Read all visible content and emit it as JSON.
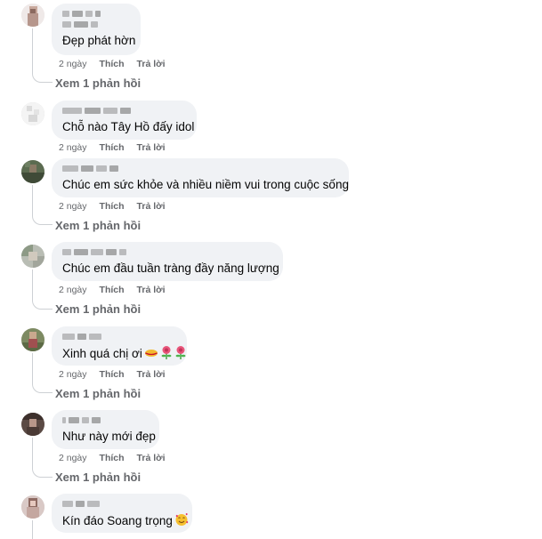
{
  "comments": [
    {
      "text": "Đẹp phát hờn",
      "time": "2 ngày",
      "like": "Thích",
      "reply": "Trả lời",
      "view_replies": "Xem 1 phản hồi",
      "emoji": []
    },
    {
      "text": "Chỗ nào Tây Hồ đấy idol",
      "time": "2 ngày",
      "like": "Thích",
      "reply": "Trả lời",
      "view_replies": "",
      "emoji": []
    },
    {
      "text": "Chúc em sức khỏe và nhiều niềm vui trong cuộc sống",
      "time": "2 ngày",
      "like": "Thích",
      "reply": "Trả lời",
      "view_replies": "Xem 1 phản hồi",
      "emoji": []
    },
    {
      "text": "Chúc em đầu tuần tràng đầy năng lượng",
      "time": "2 ngày",
      "like": "Thích",
      "reply": "Trả lời",
      "view_replies": "Xem 1 phản hồi",
      "emoji": []
    },
    {
      "text": "Xinh quá chị ơi",
      "time": "2 ngày",
      "like": "Thích",
      "reply": "Trả lời",
      "view_replies": "Xem 1 phản hồi",
      "emoji": [
        "lips-emoji",
        "flower-emoji",
        "flower-emoji"
      ]
    },
    {
      "text": "Như này mới đẹp",
      "time": "2 ngày",
      "like": "Thích",
      "reply": "Trả lời",
      "view_replies": "Xem 1 phản hồi",
      "emoji": []
    },
    {
      "text": "Kín đáo Soang trọng",
      "time": "",
      "like": "",
      "reply": "",
      "view_replies": "",
      "emoji": [
        "smiling-face-with-hearts-emoji"
      ]
    }
  ],
  "colors": {
    "bubble": "#f0f2f5",
    "text": "#050505",
    "meta": "#65676b",
    "thread_line": "#cdd0d4"
  }
}
